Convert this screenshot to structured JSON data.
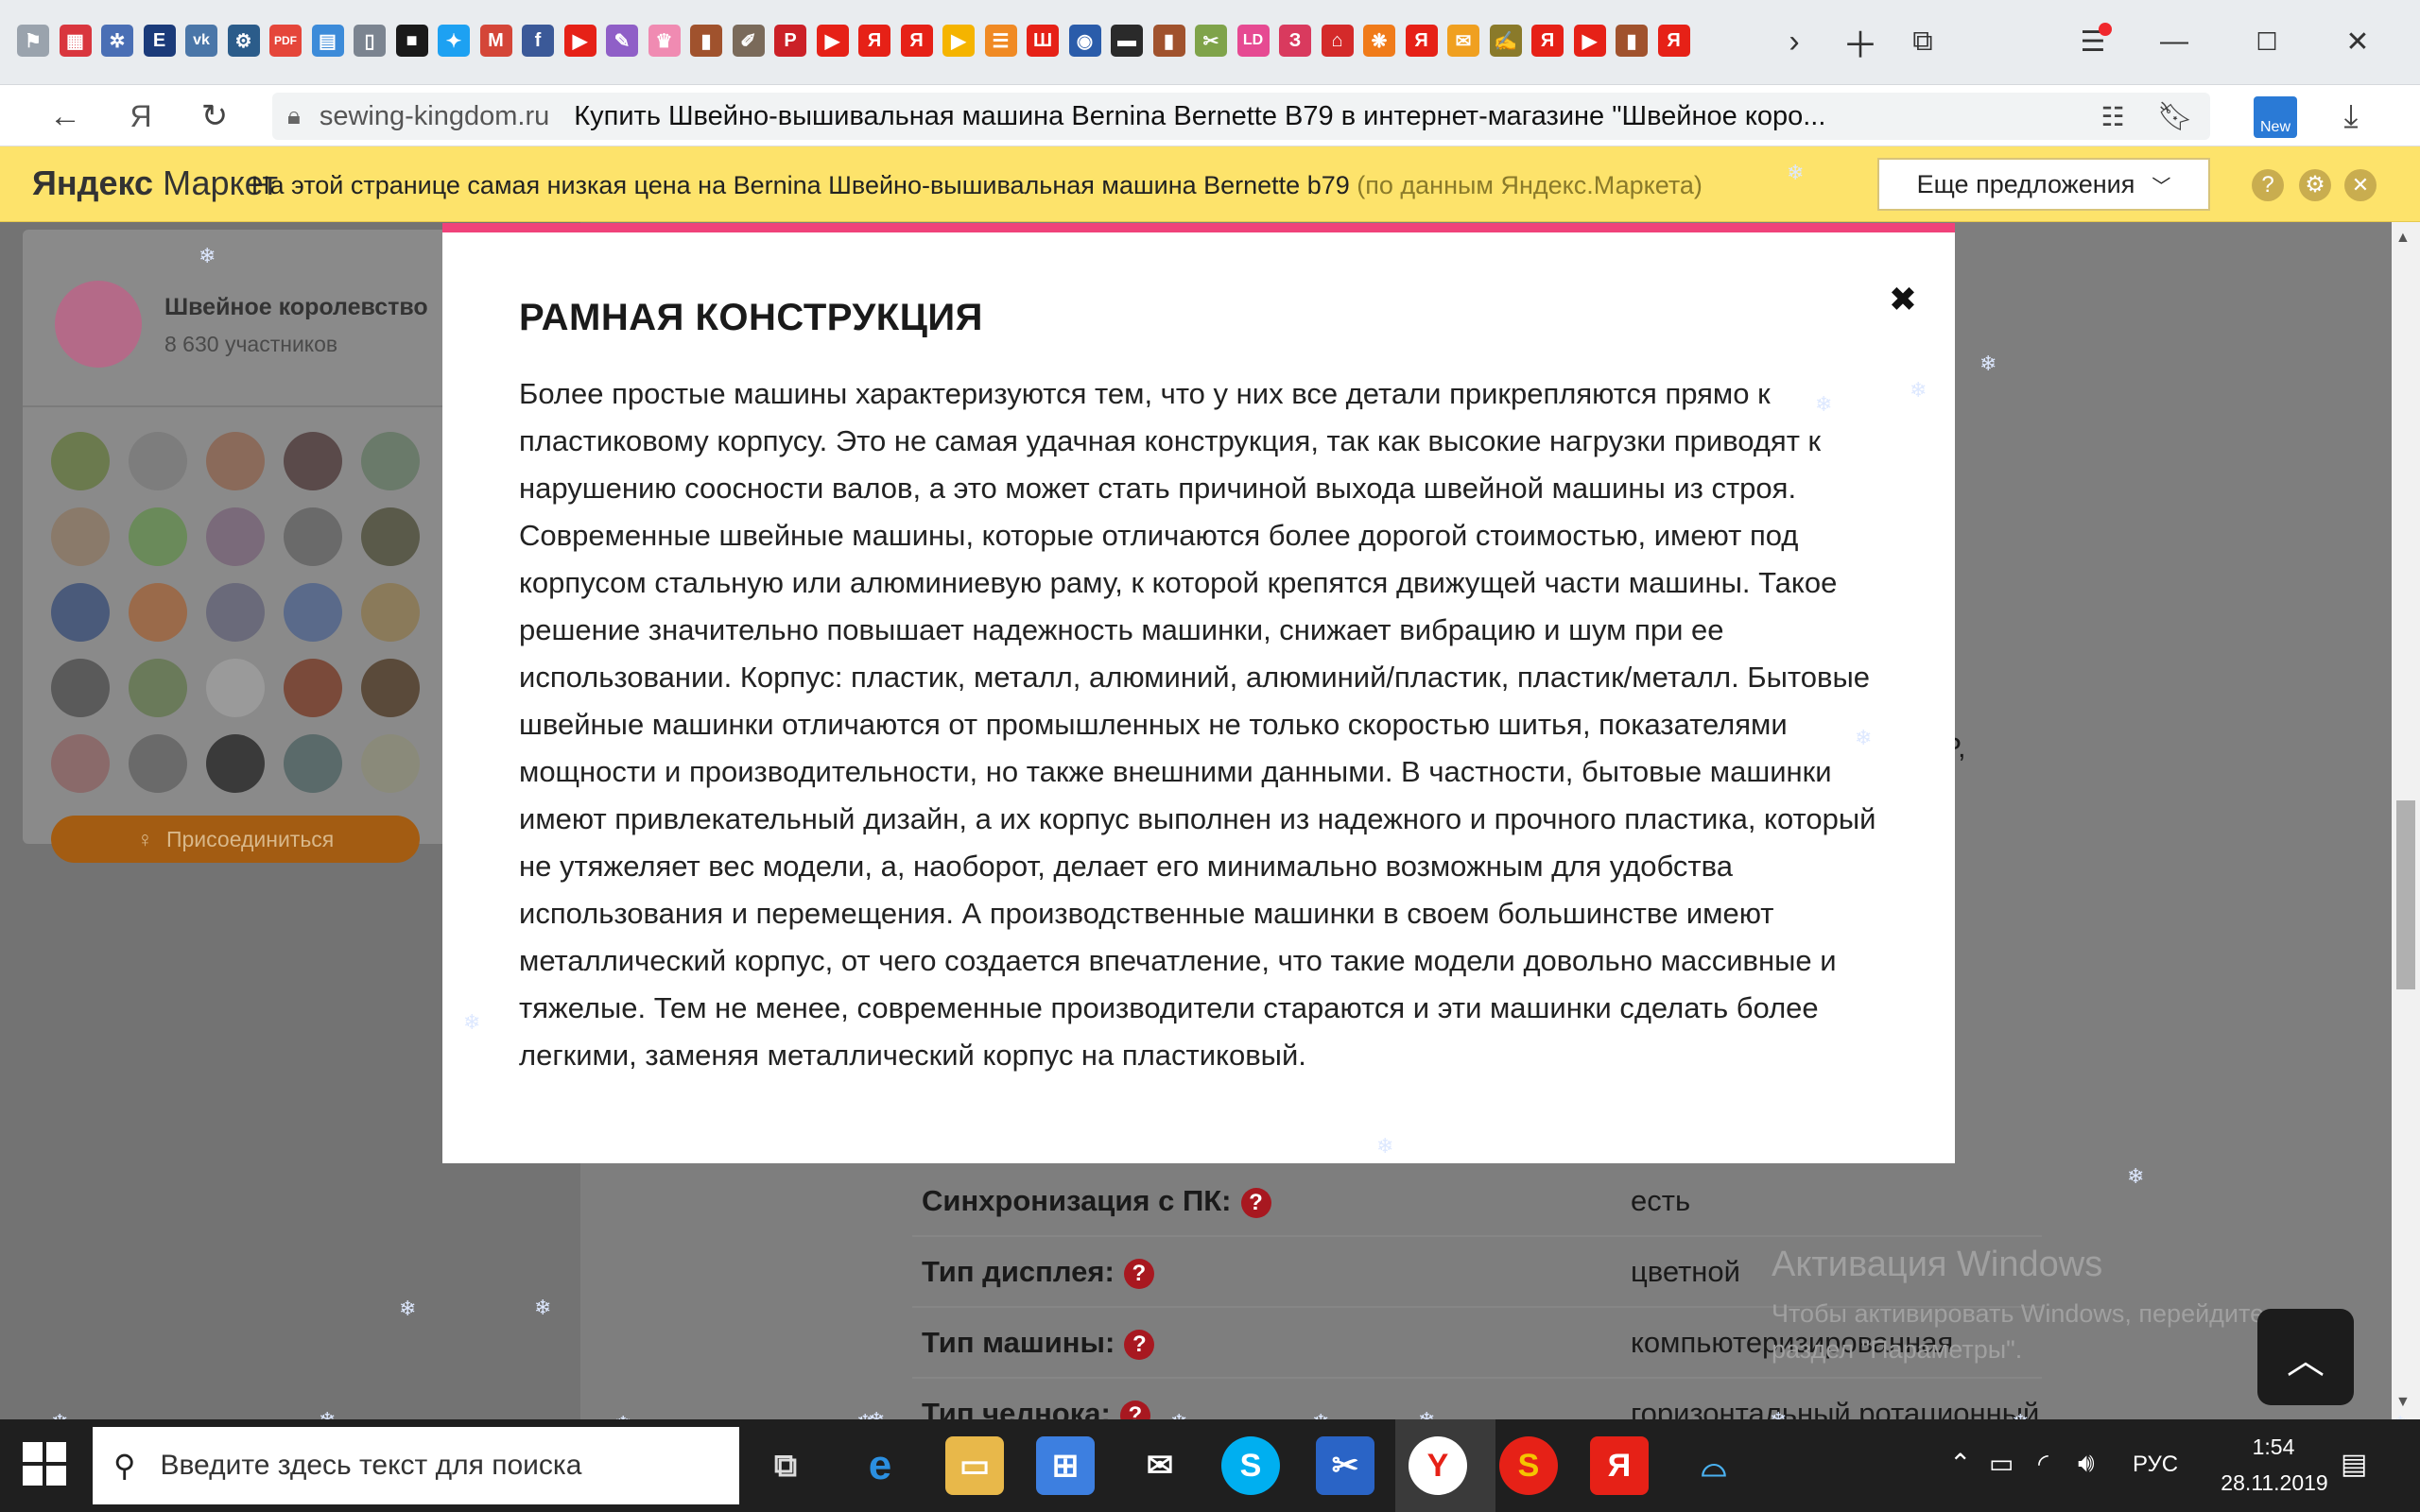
{
  "browser": {
    "tab_icons": [
      {
        "name": "bookmark-flag-icon",
        "color": "#9aa3ad",
        "glyph": "⚑"
      },
      {
        "name": "clapper-icon",
        "color": "#d9363e",
        "glyph": "▦"
      },
      {
        "name": "snowflake-app-icon",
        "color": "#4a6fb5",
        "glyph": "✲"
      },
      {
        "name": "e-icon",
        "color": "#1b3b7a",
        "glyph": "E"
      },
      {
        "name": "vk-icon",
        "color": "#4a76a8",
        "glyph": "vk"
      },
      {
        "name": "gear-app-icon",
        "color": "#2b5c8a",
        "glyph": "⚙"
      },
      {
        "name": "pdf-icon",
        "color": "#e5463a",
        "glyph": "PDF"
      },
      {
        "name": "layout-icon",
        "color": "#3c8bd9",
        "glyph": "▤"
      },
      {
        "name": "document-icon",
        "color": "#7b8490",
        "glyph": "▯"
      },
      {
        "name": "dark-app-icon",
        "color": "#1a1a1a",
        "glyph": "■"
      },
      {
        "name": "twitter-icon",
        "color": "#1da1f2",
        "glyph": "✦"
      },
      {
        "name": "gmail-icon",
        "color": "#d44638",
        "glyph": "M"
      },
      {
        "name": "facebook-icon",
        "color": "#3b5998",
        "glyph": "f"
      },
      {
        "name": "youtube-icon",
        "color": "#e62117",
        "glyph": "▶"
      },
      {
        "name": "feather-icon",
        "color": "#8f5fc7",
        "glyph": "✎"
      },
      {
        "name": "cake-icon",
        "color": "#f08bb2",
        "glyph": "♛"
      },
      {
        "name": "brown-app-icon",
        "color": "#a0522d",
        "glyph": "▮"
      },
      {
        "name": "notebook-icon",
        "color": "#7a6a5a",
        "glyph": "✐"
      },
      {
        "name": "pinterest-icon",
        "color": "#cb2027",
        "glyph": "P"
      },
      {
        "name": "youtube-icon",
        "color": "#e62117",
        "glyph": "▶"
      },
      {
        "name": "yandex-icon",
        "color": "#e62117",
        "glyph": "Я"
      },
      {
        "name": "yandex-icon",
        "color": "#e62117",
        "glyph": "Я"
      },
      {
        "name": "play-icon",
        "color": "#f5b400",
        "glyph": "▶"
      },
      {
        "name": "chat-icon",
        "color": "#f08a24",
        "glyph": "☰"
      },
      {
        "name": "sh-icon",
        "color": "#e62117",
        "glyph": "Ш"
      },
      {
        "name": "globe-icon",
        "color": "#2a5caa",
        "glyph": "◉"
      },
      {
        "name": "dark-card-icon",
        "color": "#2a2a2a",
        "glyph": "▬"
      },
      {
        "name": "bear-icon",
        "color": "#a0522d",
        "glyph": "▮"
      },
      {
        "name": "scissors-icon",
        "color": "#7fa34a",
        "glyph": "✂"
      },
      {
        "name": "ld-icon",
        "color": "#e64a92",
        "glyph": "LD"
      },
      {
        "name": "swirl-icon",
        "color": "#d93a5e",
        "glyph": "З"
      },
      {
        "name": "red-app-icon",
        "color": "#d42a2a",
        "glyph": "⌂"
      },
      {
        "name": "orange-app-icon",
        "color": "#f07b1a",
        "glyph": "❋"
      },
      {
        "name": "yandex-icon",
        "color": "#e62117",
        "glyph": "Я"
      },
      {
        "name": "mail-icon",
        "color": "#f0a020",
        "glyph": "✉"
      },
      {
        "name": "pen-icon",
        "color": "#8a7a2a",
        "glyph": "✍"
      },
      {
        "name": "yandex-icon",
        "color": "#e62117",
        "glyph": "Я"
      },
      {
        "name": "youtube-icon",
        "color": "#e62117",
        "glyph": "▶"
      },
      {
        "name": "bear-icon",
        "color": "#a0522d",
        "glyph": "▮"
      },
      {
        "name": "yandex-icon",
        "color": "#e62117",
        "glyph": "Я"
      }
    ],
    "url_domain": "sewing-kingdom.ru",
    "page_title": "Купить Швейно-вышивальная машина Bernina Bernette B79 в интернет-магазине \"Швейное коро...",
    "new_badge": "New",
    "yandex_logo": "Я"
  },
  "market_bar": {
    "logo_bold": "Яндекс",
    "logo_light": "Маркет",
    "message": "На этой странице самая низкая цена на Bernina Швейно-вышивальная машина Bernette b79",
    "source_note": "(по данным Яндекс.Маркета)",
    "more_offers": "Еще предложения"
  },
  "ok_widget": {
    "group_name": "Швейное королевство",
    "members": "8 630 участников",
    "join_button": "Присоединиться"
  },
  "specs": [
    {
      "label": "Синхронизация с ПК:",
      "value": "есть"
    },
    {
      "label": "Тип дисплея:",
      "value": "цветной"
    },
    {
      "label": "Тип машины:",
      "value": "компьютеризированная"
    },
    {
      "label": "Тип челнока:",
      "value": "горизонтальный ротационный"
    }
  ],
  "partial_text": "XP,",
  "modal": {
    "title": "РАМНАЯ КОНСТРУКЦИЯ",
    "close": "✖",
    "text": "Более простые машины характеризуются тем, что у них все детали прикрепляются прямо к пластиковому корпусу. Это не самая удачная конструкция, так как высокие нагрузки приводят к нарушению соосности валов, а это может стать причиной выхода швейной машины из строя. Современные швейные машины, которые отличаются более дорогой стоимостью, имеют под корпусом стальную или алюминиевую раму, к которой крепятся движущей части машины. Такое решение значительно повышает надежность машинки, снижает вибрацию и шум при ее использовании. Корпус: пластик, металл, алюминий, алюминий/пластик, пластик/металл. Бытовые швейные машинки отличаются от промышленных не только скоростью шитья, показателями мощности и производительности, но также внешними данными. В частности, бытовые машинки имеют привлекательный дизайн, а их корпус выполнен из надежного и прочного пластика, который не утяжеляет вес модели, а, наоборот, делает его минимально возможным для удобства использования и перемещения. А производственные машинки в своем большинстве имеют металлический корпус, от чего создается впечатление, что такие модели довольно массивные и тяжелые. Тем не менее, современные производители стараются и эти машинки сделать более легкими, заменяя металлический корпус на пластиковый."
  },
  "activation": {
    "title": "Активация Windows",
    "line1": "Чтобы активировать Windows, перейдите в",
    "line2": "раздел \"Параметры\"."
  },
  "taskbar": {
    "search_placeholder": "Введите здесь текст для поиска",
    "language": "РУС",
    "time": "1:54",
    "date": "28.11.2019"
  }
}
